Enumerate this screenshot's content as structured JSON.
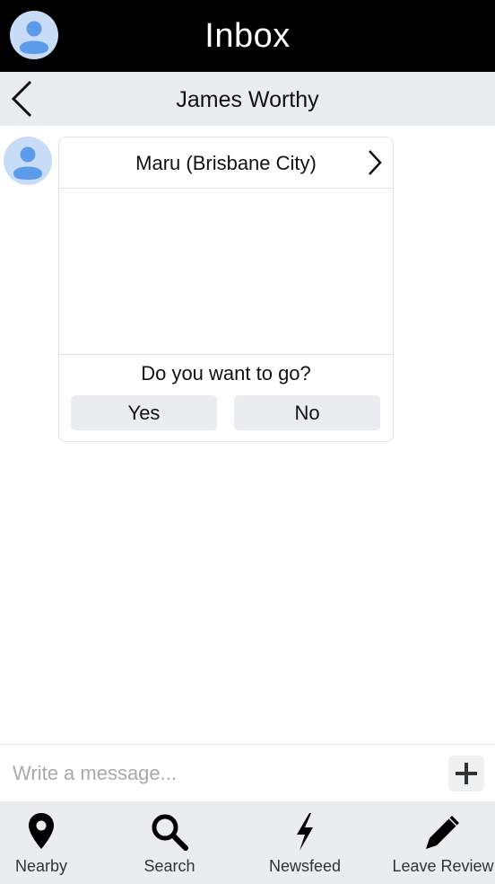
{
  "header": {
    "title": "Inbox"
  },
  "conversation": {
    "contact_name": "James Worthy"
  },
  "message_card": {
    "venue": "Maru (Brisbane City)",
    "question": "Do you want to go?",
    "yes_label": "Yes",
    "no_label": "No"
  },
  "composer": {
    "placeholder": "Write a message..."
  },
  "tabs": [
    {
      "label": "Nearby",
      "icon": "map-pin-icon"
    },
    {
      "label": "Search",
      "icon": "search-icon"
    },
    {
      "label": "Newsfeed",
      "icon": "lightning-icon"
    },
    {
      "label": "Leave Review",
      "icon": "pencil-icon"
    }
  ],
  "colors": {
    "header_bg": "#000000",
    "subheader_bg": "#eaecef",
    "avatar_light": "#c9dcf7",
    "avatar_dark": "#5b9bea"
  }
}
